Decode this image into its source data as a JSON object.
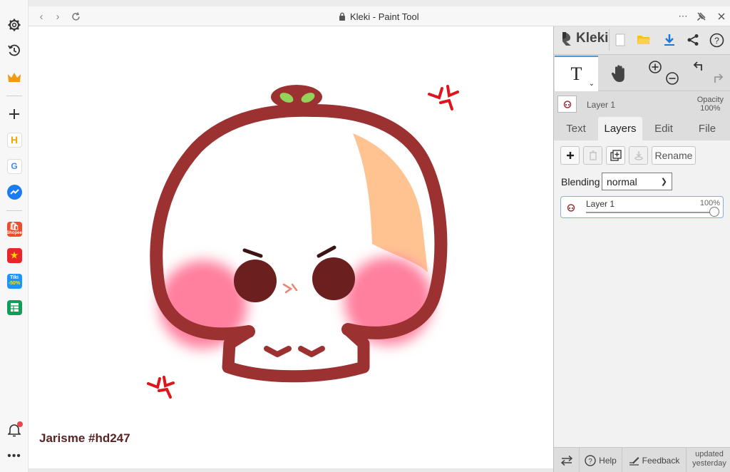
{
  "browser": {
    "title": "Kleki - Paint Tool",
    "more_icon": "more-icon",
    "pin_icon": "pin-icon"
  },
  "leftbar": {
    "items": [
      "settings-icon",
      "history-icon",
      "premium-crown-icon",
      "add-icon",
      "app-h-icon",
      "google-icon",
      "messenger-icon",
      "shopee-icon",
      "app-game-icon",
      "tiki-icon",
      "sheets-icon"
    ],
    "tiki_label": "Tiki",
    "tiki_badge": "-50%",
    "shopee_label": "Shopee"
  },
  "canvas": {
    "signature": "Jarisme #hd247"
  },
  "panel": {
    "logo": "Kleki",
    "layer_name": "Layer 1",
    "opacity_label": "Opacity",
    "opacity_value": "100%",
    "tabs": [
      "Text",
      "Layers",
      "Edit",
      "File"
    ],
    "active_tab": "Layers",
    "rename_label": "Rename",
    "blending_label": "Blending",
    "blending_value": "normal",
    "layer_item": {
      "name": "Layer 1",
      "opacity": "100%",
      "opacity_fraction": 1.0
    },
    "footer": {
      "help": "Help",
      "feedback": "Feedback",
      "updated_line1": "updated",
      "updated_line2": "yesterday"
    }
  },
  "colors": {
    "accent": "#4f9ad6",
    "outline": "#9b3131",
    "blush": "#ff7f9e",
    "shine": "#ffc392",
    "leaf": "#93d35a",
    "anger": "#e0141c"
  }
}
